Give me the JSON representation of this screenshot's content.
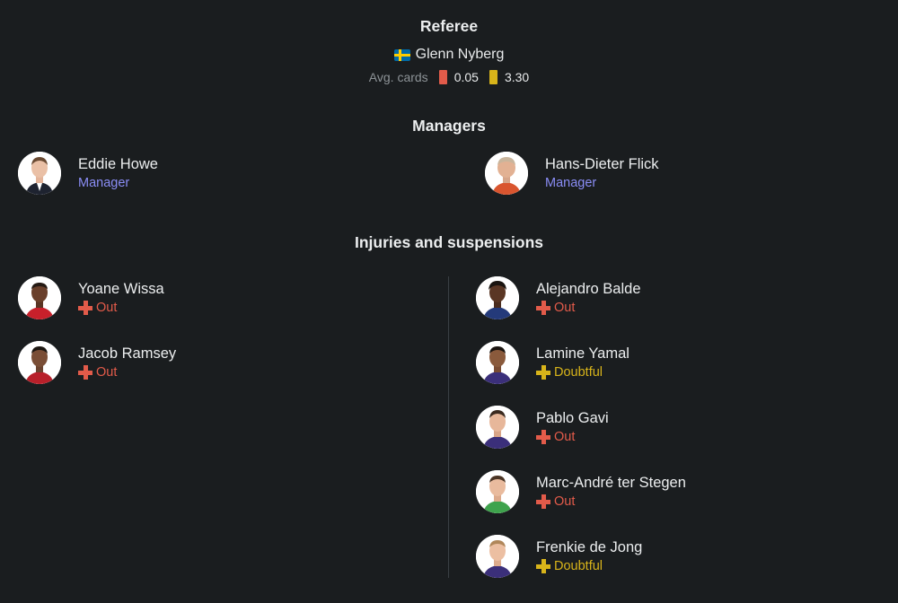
{
  "referee": {
    "title": "Referee",
    "name": "Glenn Nyberg",
    "flag_icon": "sweden-flag-icon",
    "avg_cards_label": "Avg. cards",
    "red_cards": "0.05",
    "yellow_cards": "3.30"
  },
  "managers": {
    "title": "Managers",
    "items": [
      {
        "name": "Eddie Howe",
        "role": "Manager"
      },
      {
        "name": "Hans-Dieter Flick",
        "role": "Manager"
      }
    ]
  },
  "injuries": {
    "title": "Injuries and suspensions",
    "home": [
      {
        "name": "Yoane Wissa",
        "status": "Out"
      },
      {
        "name": "Jacob Ramsey",
        "status": "Out"
      }
    ],
    "away": [
      {
        "name": "Alejandro Balde",
        "status": "Out"
      },
      {
        "name": "Lamine Yamal",
        "status": "Doubtful"
      },
      {
        "name": "Pablo Gavi",
        "status": "Out"
      },
      {
        "name": "Marc-André ter Stegen",
        "status": "Out"
      },
      {
        "name": "Frenkie de Jong",
        "status": "Doubtful"
      }
    ]
  },
  "colors": {
    "background": "#1a1d1f",
    "out": "#e25b4a",
    "doubtful": "#d8b41a",
    "manager_role": "#8a8df5"
  }
}
